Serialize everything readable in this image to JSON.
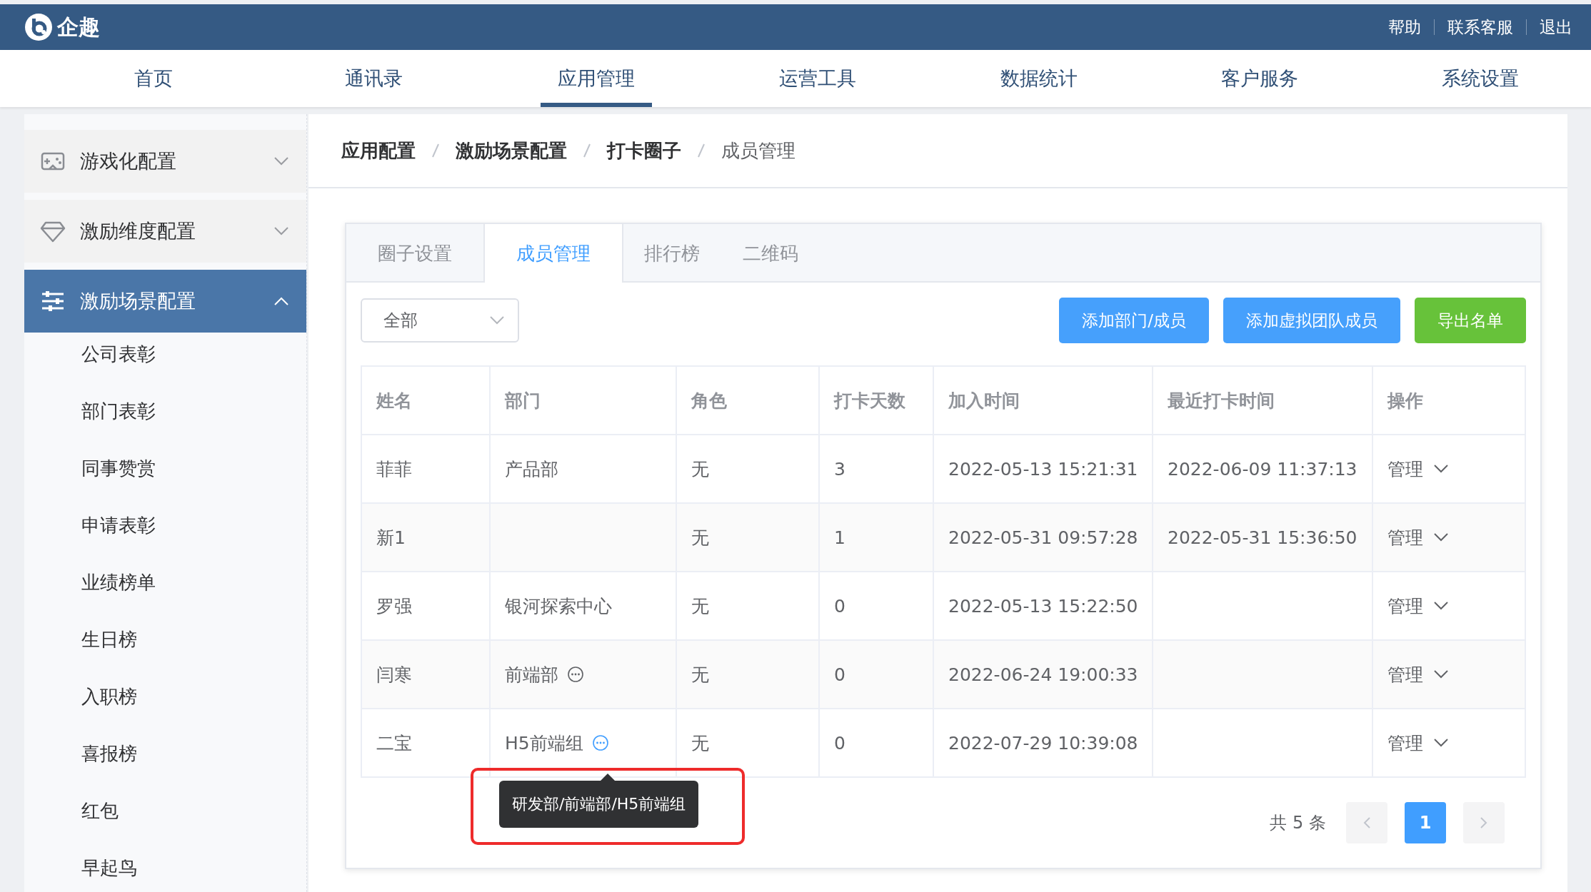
{
  "brand": {
    "name": "企趣"
  },
  "top_links": [
    "帮助",
    "联系客服",
    "退出"
  ],
  "nav": [
    {
      "label": "首页",
      "selected": false
    },
    {
      "label": "通讯录",
      "selected": false
    },
    {
      "label": "应用管理",
      "selected": true
    },
    {
      "label": "运营工具",
      "selected": false
    },
    {
      "label": "数据统计",
      "selected": false
    },
    {
      "label": "客户服务",
      "selected": false
    },
    {
      "label": "系统设置",
      "selected": false
    }
  ],
  "sidebar": {
    "groups": [
      {
        "label": "游戏化配置",
        "kind": "gamepad",
        "expanded": false,
        "selected": false
      },
      {
        "label": "激励维度配置",
        "kind": "diamond",
        "expanded": false,
        "selected": false
      },
      {
        "label": "激励场景配置",
        "kind": "sliders",
        "expanded": true,
        "selected": true,
        "children": [
          {
            "label": "公司表彰"
          },
          {
            "label": "部门表彰"
          },
          {
            "label": "同事赞赏"
          },
          {
            "label": "申请表彰"
          },
          {
            "label": "业绩榜单"
          },
          {
            "label": "生日榜"
          },
          {
            "label": "入职榜"
          },
          {
            "label": "喜报榜"
          },
          {
            "label": "红包"
          },
          {
            "label": "早起鸟"
          }
        ]
      }
    ]
  },
  "breadcrumb": [
    "应用配置",
    "激励场景配置",
    "打卡圈子",
    "成员管理"
  ],
  "tabs": [
    {
      "label": "圈子设置",
      "selected": false
    },
    {
      "label": "成员管理",
      "selected": true
    },
    {
      "label": "排行榜",
      "selected": false
    },
    {
      "label": "二维码",
      "selected": false
    }
  ],
  "filter": {
    "value": "全部"
  },
  "buttons": [
    {
      "label": "添加部门/成员",
      "kind": "primary"
    },
    {
      "label": "添加虚拟团队成员",
      "kind": "primary"
    },
    {
      "label": "导出名单",
      "kind": "success"
    }
  ],
  "table": {
    "columns": [
      "姓名",
      "部门",
      "角色",
      "打卡天数",
      "加入时间",
      "最近打卡时间",
      "操作"
    ],
    "rows": [
      {
        "name": "菲菲",
        "dept": "产品部",
        "role": "无",
        "days": "3",
        "joined": "2022-05-13 15:21:31",
        "last": "2022-06-09 11:37:13",
        "action": "管理"
      },
      {
        "name": "新1",
        "role": "无",
        "days": "1",
        "joined": "2022-05-31 09:57:28",
        "last": "2022-05-31 15:36:50",
        "action": "管理"
      },
      {
        "name": "罗强",
        "dept": "银河探索中心",
        "role": "无",
        "days": "0",
        "joined": "2022-05-13 15:22:50",
        "action": "管理"
      },
      {
        "name": "闫寒",
        "dept": "前端部",
        "path_icon": {
          "highlighted": false
        },
        "role": "无",
        "days": "0",
        "joined": "2022-06-24 19:00:33",
        "action": "管理"
      },
      {
        "name": "二宝",
        "dept": "H5前端组",
        "path_icon": {
          "highlighted": true
        },
        "tooltip": "研发部/前端部/H5前端组",
        "role": "无",
        "days": "0",
        "joined": "2022-07-29 10:39:08",
        "action": "管理"
      }
    ]
  },
  "pagination": {
    "total": "共 5 条",
    "pages": [
      {
        "label": "1",
        "selected": true
      }
    ]
  }
}
